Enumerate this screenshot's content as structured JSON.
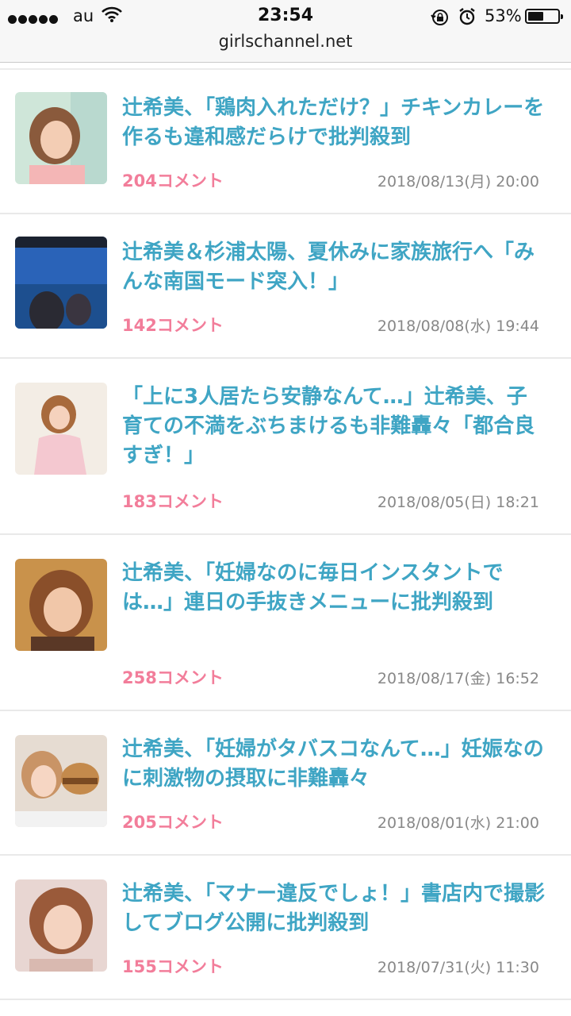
{
  "status_bar": {
    "carrier": "au",
    "time": "23:54",
    "battery": "53%",
    "battery_level": 0.53,
    "icons": [
      "signal-dots",
      "wifi-icon",
      "rotation-lock-icon",
      "alarm-icon",
      "battery-icon"
    ]
  },
  "url_bar": {
    "domain": "girlschannel.net"
  },
  "colors": {
    "title": "#3fa5c4",
    "comment_count": "#f27d9a",
    "date": "#888888"
  },
  "articles": [
    {
      "title": "辻希美、「鶏肉入れただけ？」チキンカレーを作るも違和感だらけで批判殺到",
      "comments": "204コメント",
      "date": "2018/08/13(月) 20:00"
    },
    {
      "title": "辻希美＆杉浦太陽、夏休みに家族旅行へ「みんな南国モード突入！」",
      "comments": "142コメント",
      "date": "2018/08/08(水) 19:44"
    },
    {
      "title": "「上に3人居たら安静なんて…」辻希美、子育ての不満をぶちまけるも非難轟々「都合良すぎ！」",
      "comments": "183コメント",
      "date": "2018/08/05(日) 18:21"
    },
    {
      "title": "辻希美、「妊婦なのに毎日インスタントでは…」連日の手抜きメニューに批判殺到",
      "comments": "258コメント",
      "date": "2018/08/17(金) 16:52"
    },
    {
      "title": "辻希美、「妊婦がタバスコなんて…」妊娠なのに刺激物の摂取に非難轟々",
      "comments": "205コメント",
      "date": "2018/08/01(水) 21:00"
    },
    {
      "title": "辻希美、「マナー違反でしょ！」書店内で撮影してブログ公開に批判殺到",
      "comments": "155コメント",
      "date": "2018/07/31(火) 11:30"
    }
  ]
}
